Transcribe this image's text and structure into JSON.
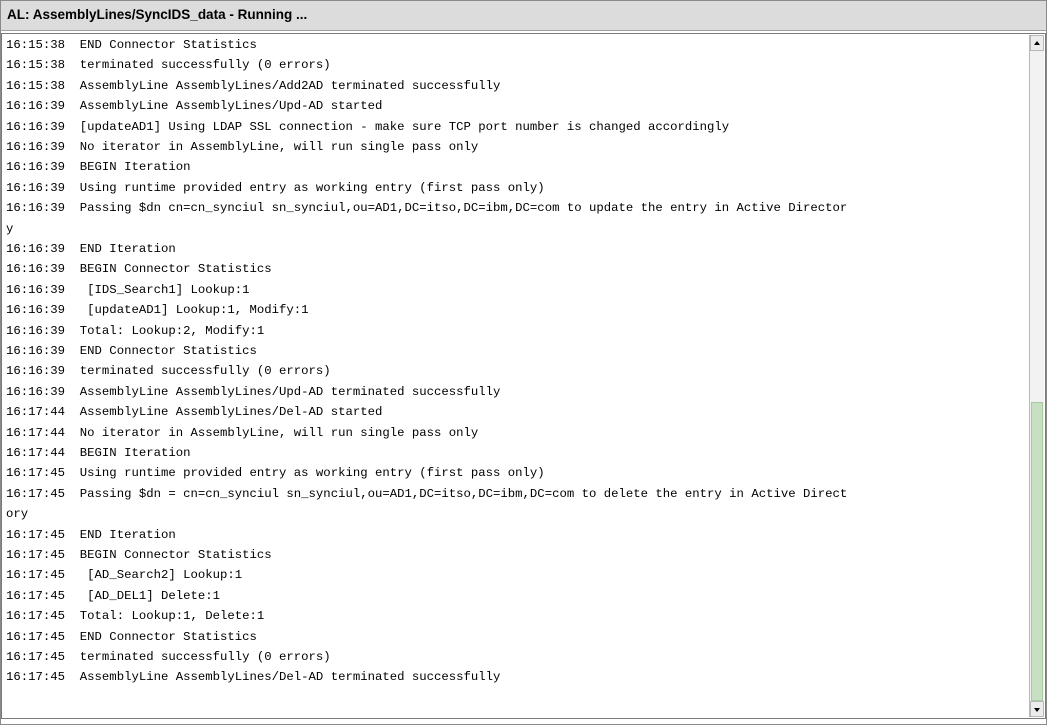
{
  "window": {
    "title": "AL: AssemblyLines/SyncIDS_data - Running ..."
  },
  "log": {
    "lines": [
      "16:15:38  END Connector Statistics",
      "16:15:38  terminated successfully (0 errors)",
      "16:15:38  AssemblyLine AssemblyLines/Add2AD terminated successfully",
      "16:16:39  AssemblyLine AssemblyLines/Upd-AD started",
      "16:16:39  [updateAD1] Using LDAP SSL connection - make sure TCP port number is changed accordingly",
      "16:16:39  No iterator in AssemblyLine, will run single pass only",
      "16:16:39  BEGIN Iteration",
      "16:16:39  Using runtime provided entry as working entry (first pass only)",
      "16:16:39  Passing $dn cn=cn_synciul sn_synciul,ou=AD1,DC=itso,DC=ibm,DC=com to update the entry in Active Director",
      "y",
      "16:16:39  END Iteration",
      "16:16:39  BEGIN Connector Statistics",
      "16:16:39   [IDS_Search1] Lookup:1",
      "16:16:39   [updateAD1] Lookup:1, Modify:1",
      "16:16:39  Total: Lookup:2, Modify:1",
      "16:16:39  END Connector Statistics",
      "16:16:39  terminated successfully (0 errors)",
      "16:16:39  AssemblyLine AssemblyLines/Upd-AD terminated successfully",
      "16:17:44  AssemblyLine AssemblyLines/Del-AD started",
      "16:17:44  No iterator in AssemblyLine, will run single pass only",
      "16:17:44  BEGIN Iteration",
      "16:17:45  Using runtime provided entry as working entry (first pass only)",
      "16:17:45  Passing $dn = cn=cn_synciul sn_synciul,ou=AD1,DC=itso,DC=ibm,DC=com to delete the entry in Active Direct",
      "ory",
      "16:17:45  END Iteration",
      "16:17:45  BEGIN Connector Statistics",
      "16:17:45   [AD_Search2] Lookup:1",
      "16:17:45   [AD_DEL1] Delete:1",
      "16:17:45  Total: Lookup:1, Delete:1",
      "16:17:45  END Connector Statistics",
      "16:17:45  terminated successfully (0 errors)",
      "16:17:45  AssemblyLine AssemblyLines/Del-AD terminated successfully"
    ]
  },
  "scrollbar": {
    "up_icon": "arrow-up-icon",
    "down_icon": "arrow-down-icon",
    "thumb_color": "#d9ecd5",
    "position_fraction": 0.54,
    "visible_fraction": 0.46
  }
}
